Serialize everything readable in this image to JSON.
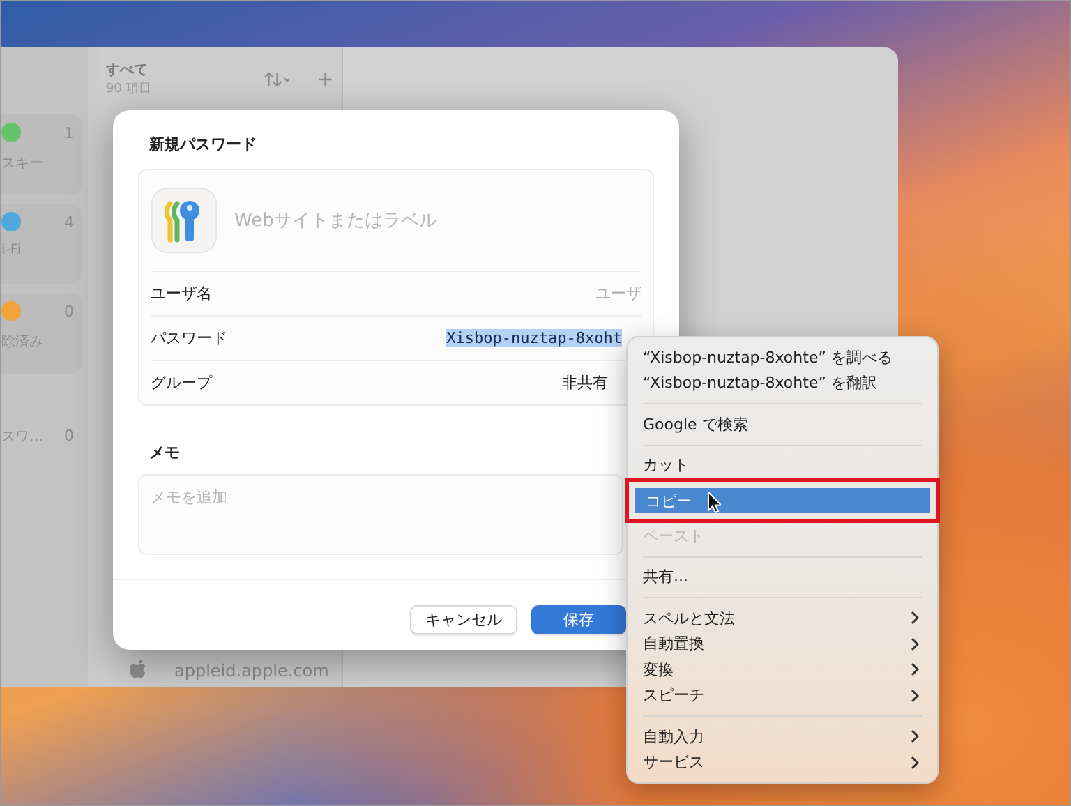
{
  "sidebar": {
    "tiles": [
      {
        "label": "スキー",
        "count": "1",
        "color": "#62c46a"
      },
      {
        "label": "i-Fi",
        "count": "4",
        "color": "#4fa8dc"
      },
      {
        "label": "除済み",
        "count": "0",
        "color": "#f2a33a"
      }
    ],
    "rows": [
      {
        "label": "スワ…",
        "count": "0"
      }
    ]
  },
  "list": {
    "title": "すべて",
    "subtitle": "90 項目",
    "footer_item": "appleid.apple.com"
  },
  "dialog": {
    "title": "新規パスワード",
    "site_field": {
      "placeholder": "Webサイトまたはラベル"
    },
    "rows": [
      {
        "kind": "placeholder",
        "label": "ユーザ名",
        "placeholder": "ユーザ"
      },
      {
        "kind": "selected-text",
        "label": "パスワード",
        "value": "Xisbop-nuztap-8xoht"
      },
      {
        "kind": "popup",
        "label": "グループ",
        "value": "非共有"
      }
    ],
    "memo": {
      "label": "メモ",
      "placeholder": "メモを追加"
    },
    "buttons": [
      {
        "label": "キャンセル",
        "default": false
      },
      {
        "label": "保存",
        "default": true
      }
    ]
  },
  "context_menu": {
    "groups": [
      [
        {
          "label": "“Xisbop-nuztap-8xohte” を調べる",
          "selected": false,
          "disabled": false,
          "submenu": false,
          "annotated": false
        },
        {
          "label": "“Xisbop-nuztap-8xohte” を翻訳",
          "selected": false,
          "disabled": false,
          "submenu": false,
          "annotated": false
        }
      ],
      [
        {
          "label": "Google で検索",
          "selected": false,
          "disabled": false,
          "submenu": false,
          "annotated": false
        }
      ],
      [
        {
          "label": "カット",
          "selected": false,
          "disabled": false,
          "submenu": false,
          "annotated": false
        },
        {
          "label": "コピー",
          "selected": true,
          "disabled": false,
          "submenu": false,
          "annotated": true
        },
        {
          "label": "ペースト",
          "selected": false,
          "disabled": true,
          "submenu": false,
          "annotated": false
        }
      ],
      [
        {
          "label": "共有...",
          "selected": false,
          "disabled": false,
          "submenu": false,
          "annotated": false
        }
      ],
      [
        {
          "label": "スペルと文法",
          "selected": false,
          "disabled": false,
          "submenu": true,
          "annotated": false
        },
        {
          "label": "自動置換",
          "selected": false,
          "disabled": false,
          "submenu": true,
          "annotated": false
        },
        {
          "label": "変換",
          "selected": false,
          "disabled": false,
          "submenu": true,
          "annotated": false
        },
        {
          "label": "スピーチ",
          "selected": false,
          "disabled": false,
          "submenu": true,
          "annotated": false
        }
      ],
      [
        {
          "label": "自動入力",
          "selected": false,
          "disabled": false,
          "submenu": true,
          "annotated": false
        },
        {
          "label": "サービス",
          "selected": false,
          "disabled": false,
          "submenu": true,
          "annotated": false
        }
      ]
    ]
  }
}
